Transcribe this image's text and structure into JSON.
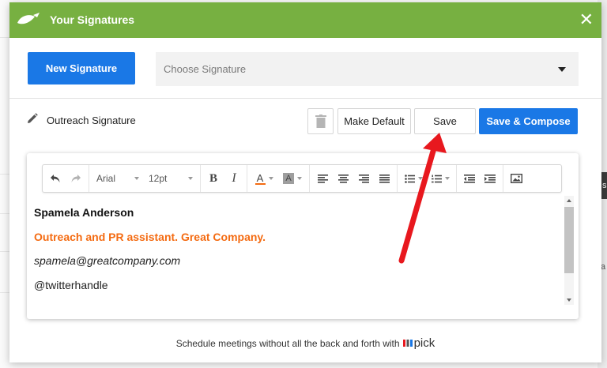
{
  "header": {
    "title": "Your Signatures",
    "close_glyph": "✕",
    "color": "#77b041"
  },
  "toolbar_top": {
    "new_signature_label": "New Signature",
    "choose_placeholder": "Choose Signature"
  },
  "signature": {
    "name": "Outreach Signature",
    "make_default_label": "Make Default",
    "save_label": "Save",
    "save_compose_label": "Save & Compose"
  },
  "editor_toolbar": {
    "font_name": "Arial",
    "font_size": "12pt",
    "bold_glyph": "B",
    "italic_glyph": "I",
    "font_color_glyph": "A",
    "highlight_glyph": "A"
  },
  "editor_content": {
    "name": "Spamela Anderson",
    "title_line": "Outreach and PR assistant. Great Company.",
    "email": "spamela@greatcompany.com",
    "handle": "@twitterhandle",
    "title_color": "#f46b12"
  },
  "footer": {
    "text": "Schedule meetings without all the back and forth with",
    "brand": "pick"
  },
  "background": {
    "dark_fragment": "s",
    "text_fragment": "a"
  },
  "colors": {
    "primary_button": "#1a78e6",
    "annotation_arrow": "#e8181e"
  }
}
